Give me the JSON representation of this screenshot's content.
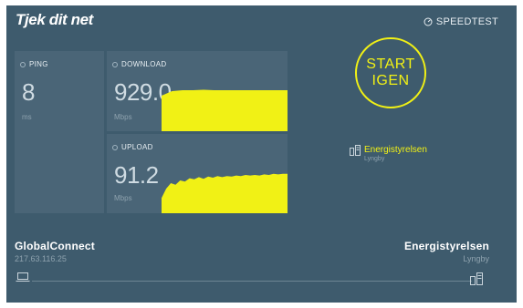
{
  "header": {
    "logo_text": "Tjek dit net",
    "speedtest_label": "SPEEDTEST",
    "speedtest_icon": "gauge-icon"
  },
  "ping": {
    "label": "PING",
    "value": "8",
    "unit": "ms"
  },
  "download": {
    "label": "DOWNLOAD",
    "value": "929.0",
    "unit": "Mbps",
    "graph_samples": [
      0.78,
      0.88,
      0.9,
      0.9,
      0.91,
      0.9,
      0.9,
      0.9,
      0.9,
      0.9,
      0.9,
      0.9,
      0.9
    ]
  },
  "upload": {
    "label": "UPLOAD",
    "value": "91.2",
    "unit": "Mbps",
    "graph_samples": [
      0.28,
      0.45,
      0.55,
      0.52,
      0.6,
      0.58,
      0.64,
      0.62,
      0.66,
      0.63,
      0.67,
      0.65,
      0.68,
      0.66,
      0.68,
      0.67,
      0.69,
      0.68,
      0.7,
      0.69,
      0.7,
      0.69,
      0.71,
      0.7,
      0.72,
      0.71,
      0.72,
      0.72
    ]
  },
  "start_button": {
    "line1": "START",
    "line2": "IGEN"
  },
  "server": {
    "name": "Energistyrelsen",
    "location": "Lyngby"
  },
  "connection": {
    "isp_name": "GlobalConnect",
    "ip": "217.63.116.25",
    "host_name": "Energistyrelsen",
    "host_location": "Lyngby"
  },
  "colors": {
    "background": "#3e5b6d",
    "tile": "#4a6577",
    "accent": "#f1f115"
  }
}
